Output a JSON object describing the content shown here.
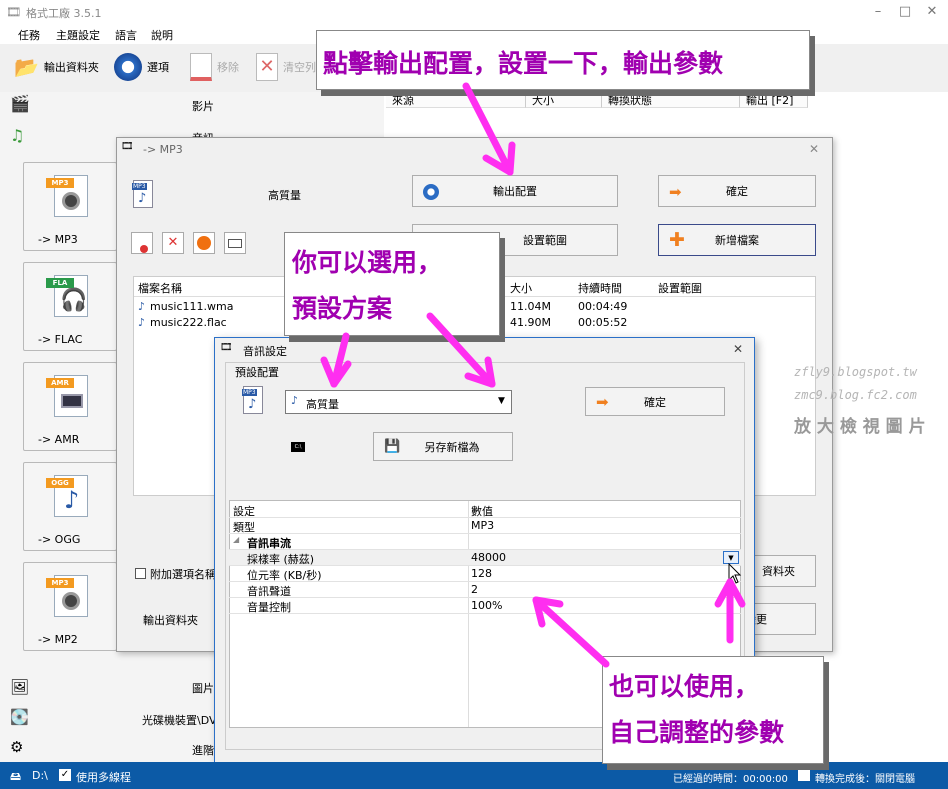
{
  "window": {
    "title": "格式工廠 3.5.1",
    "menu": [
      "任務",
      "主題設定",
      "語言",
      "說明"
    ]
  },
  "toolbar": {
    "output_folder": "輸出資料夾",
    "options": "選項",
    "remove": "移除",
    "clear": "清空列表"
  },
  "sidebar": {
    "video": "影片",
    "audio": "音訊",
    "picture": "圖片",
    "rom": "光碟機裝置\\DVD\\CD\\ISO",
    "advanced": "進階",
    "formats": [
      {
        "tag": "MP3",
        "label": "-> MP3"
      },
      {
        "tag": "FLA",
        "label": "-> FLAC"
      },
      {
        "tag": "AMR",
        "label": "-> AMR"
      },
      {
        "tag": "OGG",
        "label": "-> OGG"
      },
      {
        "tag": "MP3",
        "label": "-> MP2"
      }
    ]
  },
  "task_list": {
    "columns": [
      "來源",
      "大小",
      "轉換狀態",
      "輸出 [F2]"
    ]
  },
  "mp3_dialog": {
    "title": "-> MP3",
    "quality": "高質量",
    "output_config": "輸出配置",
    "ok": "確定",
    "set_range": "設置範圍",
    "add_file": "新增檔案",
    "columns": [
      "檔案名稱",
      "大小",
      "持續時間",
      "設置範圍"
    ],
    "files": [
      {
        "name": "music111.wma",
        "size": "11.04M",
        "duration": "00:04:49"
      },
      {
        "name": "music222.flac",
        "size": "41.90M",
        "duration": "00:05:52"
      }
    ],
    "append_option": "附加選項名稱",
    "output_folder": "輸出資料夾",
    "browse": "資料夾",
    "change": "變更"
  },
  "audio_dialog": {
    "title": "音訊設定",
    "preset_label": "預設配置",
    "preset_value": "高質量",
    "ok": "確定",
    "save_as": "另存新檔為",
    "grid_header": {
      "setting": "設定",
      "value": "數值"
    },
    "type_row": {
      "name": "類型",
      "value": "MP3"
    },
    "group": "音訊串流",
    "rows": [
      {
        "name": "採樣率 (赫茲)",
        "value": "48000"
      },
      {
        "name": "位元率 (KB/秒)",
        "value": "128"
      },
      {
        "name": "音訊聲道",
        "value": "2"
      },
      {
        "name": "音量控制",
        "value": "100%"
      }
    ]
  },
  "status_bar": {
    "drive": "D:\\",
    "multithread": "使用多線程",
    "elapsed": "已經過的時間：00:00:00",
    "after_done": "轉換完成後：關閉電腦"
  },
  "callouts": {
    "c1": "點擊輸出配置，設置一下，輸出參數",
    "c2a": "你可以選用，",
    "c2b": "預設方案",
    "c3a": "也可以使用，",
    "c3b": "自己調整的參數"
  },
  "watermark": {
    "line1": "zfly9.blogspot.tw",
    "line2": "zmc9.blog.fc2.com",
    "line3": "放 大 檢 視 圖 片"
  },
  "colors": {
    "status_bar": "#0c5aa6",
    "callout_text": "#a000b0",
    "arrow": "#ff2ef0",
    "format_tag": "#f39a20"
  }
}
